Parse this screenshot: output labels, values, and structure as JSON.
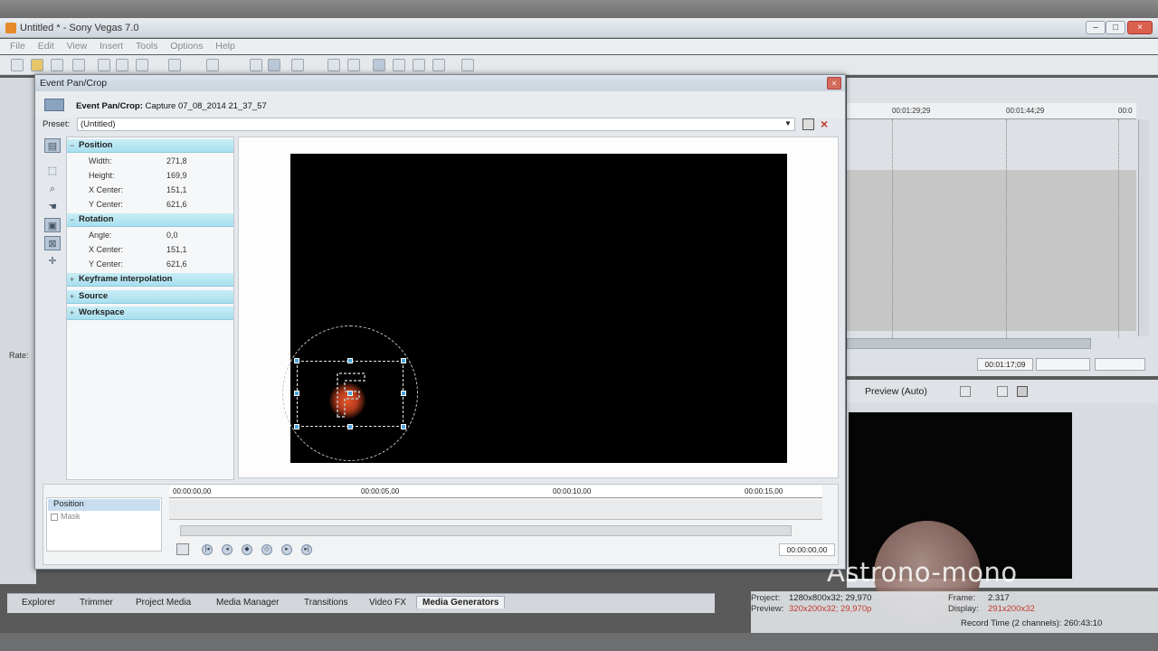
{
  "app": {
    "title": "Untitled * - Sony Vegas 7.0",
    "menu": [
      "File",
      "Edit",
      "View",
      "Insert",
      "Tools",
      "Options",
      "Help"
    ],
    "min_label": "–",
    "max_label": "□",
    "close_label": "×"
  },
  "dialog": {
    "title": "Event Pan/Crop",
    "close_label": "×",
    "header_label": "Event Pan/Crop:",
    "header_value": "Capture 07_08_2014 21_37_57",
    "preset_label": "Preset:",
    "preset_value": "(Untitled)",
    "sections": {
      "position": {
        "title": "Position",
        "rows": [
          {
            "label": "Width:",
            "value": "271,8"
          },
          {
            "label": "Height:",
            "value": "169,9"
          },
          {
            "label": "X Center:",
            "value": "151,1"
          },
          {
            "label": "Y Center:",
            "value": "621,6"
          }
        ]
      },
      "rotation": {
        "title": "Rotation",
        "rows": [
          {
            "label": "Angle:",
            "value": "0,0"
          },
          {
            "label": "X Center:",
            "value": "151,1"
          },
          {
            "label": "Y Center:",
            "value": "621,6"
          }
        ]
      },
      "keyframe": {
        "title": "Keyframe interpolation"
      },
      "source": {
        "title": "Source"
      },
      "workspace": {
        "title": "Workspace"
      }
    },
    "timeline": {
      "tracks": [
        "Position",
        "Mask"
      ],
      "ticks": [
        "00:00:00,00",
        "00:00:05,00",
        "00:00:10,00",
        "00:00:15,00"
      ],
      "time": "00:00:00,00"
    }
  },
  "project": {
    "ruler_ticks": [
      "00:01:29;29",
      "00:01:44;29",
      "00:0"
    ],
    "time_display": "00:01:17;09",
    "preview_label": "Preview (Auto)",
    "rate_label": "Rate:",
    "props": {
      "project_label": "Project:",
      "project_value": "1280x800x32; 29,970",
      "preview_label": "Preview:",
      "preview_value": "320x200x32; 29,970p",
      "frame_label": "Frame:",
      "frame_value": "2.317",
      "display_label": "Display:",
      "display_value": "291x200x32"
    },
    "record_time": "Record Time (2 channels): 260:43:10"
  },
  "bottom_tabs": [
    "Explorer",
    "Trimmer",
    "Project Media",
    "Media Manager",
    "Transitions",
    "Video FX",
    "Media Generators"
  ],
  "watermark": "Astrono-mono",
  "colors": {
    "section_header": "#a8e0ef",
    "accent_handle": "#4aa3df",
    "alert_red": "#c0392b"
  }
}
